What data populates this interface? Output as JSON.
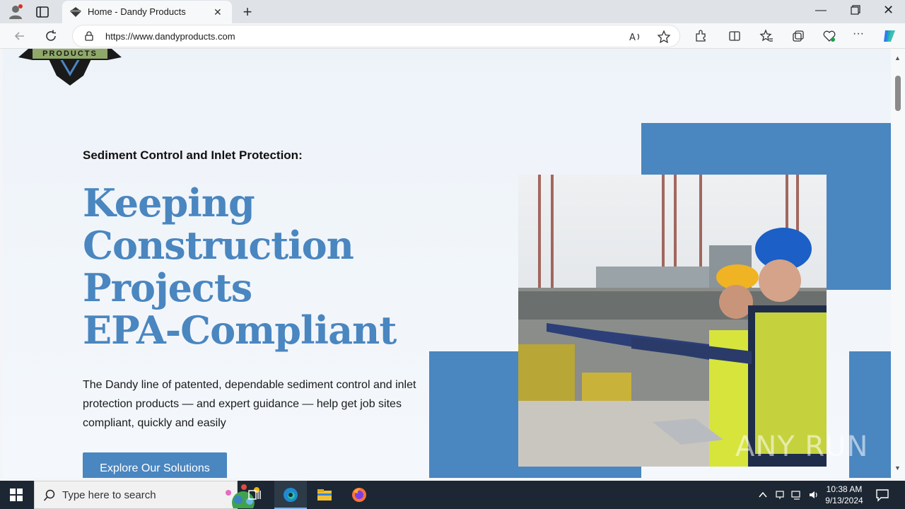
{
  "browser": {
    "tab_title": "Home - Dandy Products",
    "url_protocol": "https://",
    "url_host": "www.dandyproducts.com"
  },
  "page": {
    "logo_text": "PRODUCTS",
    "subtitle": "Sediment Control and Inlet Protection:",
    "headline_lines": [
      "Keeping",
      "Construction",
      "Projects",
      "EPA-Compliant"
    ],
    "description": "The Dandy line of patented, dependable sediment control and inlet protection products — and expert guidance — help get job sites compliant, quickly and easily",
    "cta_label": "Explore Our Solutions",
    "accent_color": "#4a86c0",
    "watermark": "ANY RUN"
  },
  "taskbar": {
    "search_placeholder": "Type here to search",
    "time": "10:38 AM",
    "date": "9/13/2024"
  }
}
